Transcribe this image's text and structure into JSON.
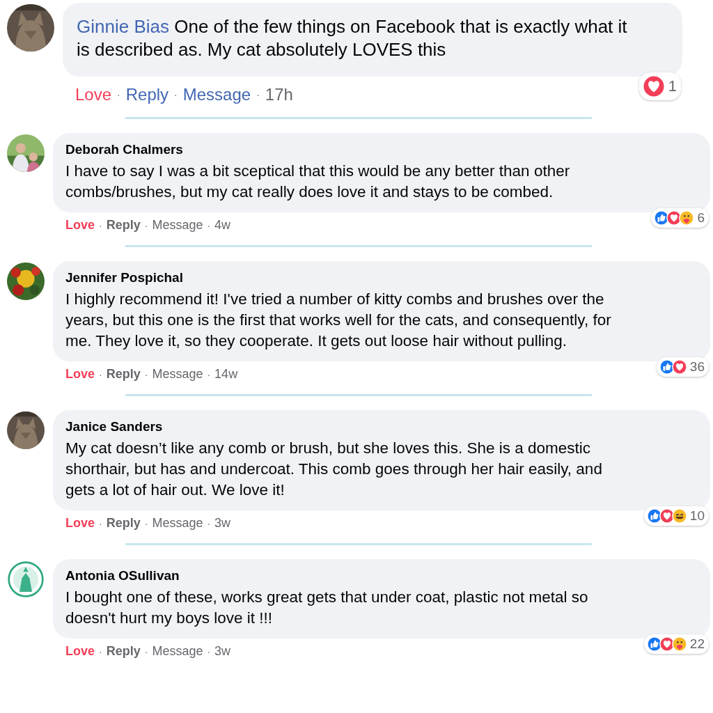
{
  "comments": [
    {
      "kind": "inline",
      "author": "Ginnie Bias",
      "text": "One of the few things on Facebook that is exactly what it is described as. My cat absolutely LOVES this",
      "actions": [
        "Love",
        "Reply",
        "Message"
      ],
      "separator": "·",
      "time": "17h",
      "reactions": [
        {
          "kind": "love"
        }
      ],
      "reaction_count": "1"
    },
    {
      "kind": "block",
      "author": "Deborah Chalmers",
      "text": "I have to say I was a bit sceptical that this would be any better than other combs/brushes, but my cat really does love it and stays to be combed.",
      "actions": [
        "Love",
        "Reply",
        "Message"
      ],
      "separator": "·",
      "time": "4w",
      "reactions": [
        {
          "kind": "like"
        },
        {
          "kind": "love"
        },
        {
          "kind": "care"
        }
      ],
      "reaction_count": "6"
    },
    {
      "kind": "block",
      "author": "Jennifer Pospichal",
      "text": "I highly recommend it! I've tried a number of kitty combs and brushes over the years, but this one is the first that works well for the cats, and consequently, for me. They love it, so they cooperate. It gets out loose hair without pulling.",
      "actions": [
        "Love",
        "Reply",
        "Message"
      ],
      "separator": "·",
      "time": "14w",
      "reactions": [
        {
          "kind": "like"
        },
        {
          "kind": "love"
        }
      ],
      "reaction_count": "36"
    },
    {
      "kind": "block",
      "author": "Janice Sanders",
      "text": "My cat doesn’t like any comb or brush, but she loves this. She is a domestic shorthair, but has and undercoat. This comb goes through her hair easily, and gets a lot of hair out. We love it!",
      "actions": [
        "Love",
        "Reply",
        "Message"
      ],
      "separator": "·",
      "time": "3w",
      "reactions": [
        {
          "kind": "like"
        },
        {
          "kind": "love"
        },
        {
          "kind": "haha"
        }
      ],
      "reaction_count": "10"
    },
    {
      "kind": "block",
      "author": "Antonia OSullivan",
      "text": "I bought one of these, works great gets that under coat, plastic not metal so doesn't hurt my boys love it !!!",
      "actions": [
        "Love",
        "Reply",
        "Message"
      ],
      "separator": "·",
      "time": "3w",
      "reactions": [
        {
          "kind": "like"
        },
        {
          "kind": "love"
        },
        {
          "kind": "care"
        }
      ],
      "reaction_count": "22"
    }
  ]
}
